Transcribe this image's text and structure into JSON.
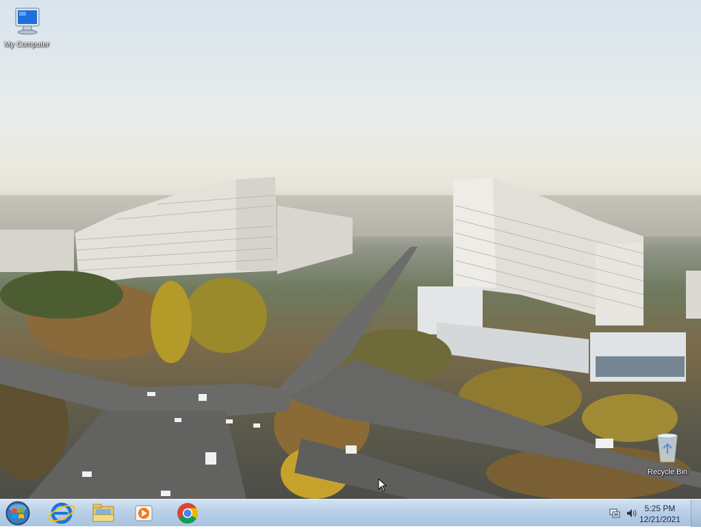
{
  "desktop": {
    "icons": [
      {
        "name": "my-computer",
        "label": "My Computer",
        "icon": "computer-monitor-icon"
      },
      {
        "name": "recycle-bin",
        "label": "Recycle Bin",
        "icon": "recycle-bin-icon"
      }
    ],
    "wallpaper": "city-avenue-aerial-autumn"
  },
  "taskbar": {
    "start_icon": "windows-start-orb-icon",
    "pinned": [
      {
        "name": "internet-explorer",
        "icon": "internet-explorer-icon"
      },
      {
        "name": "file-explorer",
        "icon": "folder-library-icon"
      },
      {
        "name": "media-player",
        "icon": "media-player-icon"
      },
      {
        "name": "chrome",
        "icon": "chrome-icon"
      }
    ],
    "tray_icons": [
      "network-icon",
      "volume-icon"
    ],
    "clock": {
      "time": "5:25 PM",
      "date": "12/21/2021"
    }
  },
  "colors": {
    "taskbar": "#b9d0e8",
    "ie_blue": "#1e73d8",
    "chrome_red": "#db4437",
    "chrome_green": "#0f9d58",
    "chrome_yellow": "#f4b400"
  }
}
